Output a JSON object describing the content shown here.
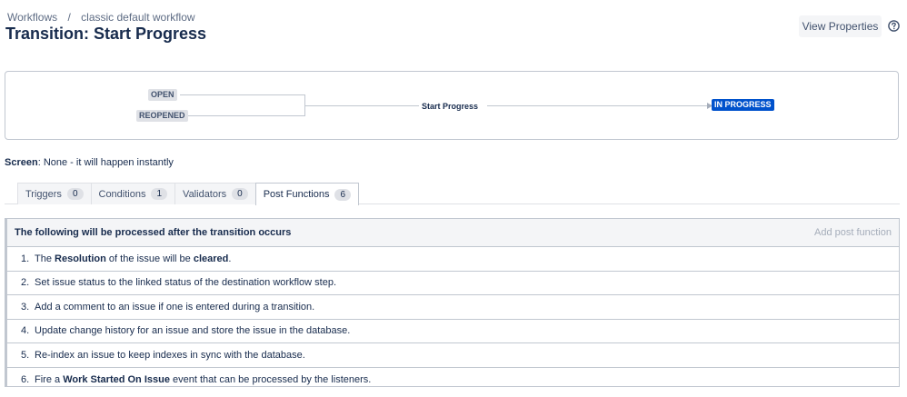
{
  "breadcrumb": {
    "root": "Workflows",
    "separator": "/",
    "current": "classic default workflow"
  },
  "page_title": "Transition: Start Progress",
  "header": {
    "view_properties": "View Properties",
    "help_icon": "help-icon"
  },
  "diagram": {
    "from_statuses": [
      "OPEN",
      "REOPENED"
    ],
    "transition": "Start Progress",
    "to_status": "IN PROGRESS",
    "colors": {
      "target": "#0052cc",
      "source": "#dfe1e6"
    }
  },
  "screen": {
    "label": "Screen",
    "value": ": None - it will happen instantly"
  },
  "tabs": [
    {
      "label": "Triggers",
      "count": "0"
    },
    {
      "label": "Conditions",
      "count": "1"
    },
    {
      "label": "Validators",
      "count": "0"
    },
    {
      "label": "Post Functions",
      "count": "6",
      "active": true
    }
  ],
  "post_functions": {
    "header": "The following will be processed after the transition occurs",
    "add_label": "Add post function",
    "items": [
      {
        "num": "1.",
        "parts": [
          "The ",
          "Resolution",
          " of the issue will be ",
          "cleared",
          "."
        ]
      },
      {
        "num": "2.",
        "text": "Set issue status to the linked status of the destination workflow step."
      },
      {
        "num": "3.",
        "text": "Add a comment to an issue if one is entered during a transition."
      },
      {
        "num": "4.",
        "text": "Update change history for an issue and store the issue in the database."
      },
      {
        "num": "5.",
        "text": "Re-index an issue to keep indexes in sync with the database."
      },
      {
        "num": "6.",
        "parts": [
          "Fire a ",
          "Work Started On Issue",
          " event that can be processed by the listeners."
        ]
      }
    ]
  }
}
